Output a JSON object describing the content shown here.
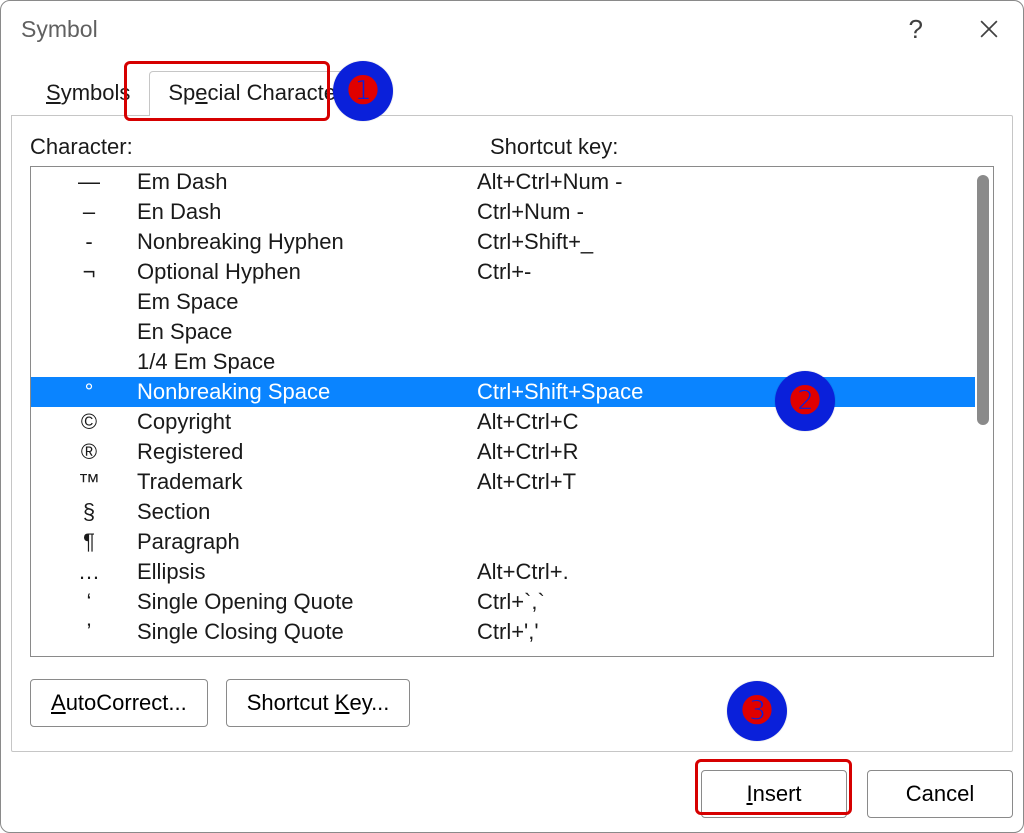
{
  "title": "Symbol",
  "tabs": {
    "symbols": {
      "prefix": "S",
      "rest": "ymbols"
    },
    "special": {
      "prefix": "Sp",
      "mn": "e",
      "rest": "cial Characters"
    }
  },
  "headers": {
    "char": {
      "mn": "C",
      "rest": "haracter:"
    },
    "key": "Shortcut key:"
  },
  "rows": [
    {
      "glyph": "—",
      "name": "Em Dash",
      "shortcut": "Alt+Ctrl+Num -"
    },
    {
      "glyph": "–",
      "name": "En Dash",
      "shortcut": "Ctrl+Num -"
    },
    {
      "glyph": "-",
      "name": "Nonbreaking Hyphen",
      "shortcut": "Ctrl+Shift+_"
    },
    {
      "glyph": "¬",
      "name": "Optional Hyphen",
      "shortcut": "Ctrl+-"
    },
    {
      "glyph": "",
      "name": "Em Space",
      "shortcut": ""
    },
    {
      "glyph": "",
      "name": "En Space",
      "shortcut": ""
    },
    {
      "glyph": "",
      "name": "1/4 Em Space",
      "shortcut": ""
    },
    {
      "glyph": "°",
      "name": "Nonbreaking Space",
      "shortcut": "Ctrl+Shift+Space",
      "selected": true
    },
    {
      "glyph": "©",
      "name": "Copyright",
      "shortcut": "Alt+Ctrl+C"
    },
    {
      "glyph": "®",
      "name": "Registered",
      "shortcut": "Alt+Ctrl+R"
    },
    {
      "glyph": "™",
      "name": "Trademark",
      "shortcut": "Alt+Ctrl+T"
    },
    {
      "glyph": "§",
      "name": "Section",
      "shortcut": ""
    },
    {
      "glyph": "¶",
      "name": "Paragraph",
      "shortcut": ""
    },
    {
      "glyph": "…",
      "name": "Ellipsis",
      "shortcut": "Alt+Ctrl+."
    },
    {
      "glyph": "‘",
      "name": "Single Opening Quote",
      "shortcut": "Ctrl+`,`"
    },
    {
      "glyph": "’",
      "name": "Single Closing Quote",
      "shortcut": "Ctrl+','"
    }
  ],
  "buttons": {
    "autocorrect": {
      "mn": "A",
      "rest": "utoCorrect..."
    },
    "shortcutkey": {
      "pre": "Shortcut ",
      "mn": "K",
      "rest": "ey..."
    },
    "insert": {
      "mn": "I",
      "rest": "nsert"
    },
    "cancel": "Cancel"
  },
  "annotations": {
    "n1": "➊",
    "n2": "➋",
    "n3": "➌"
  }
}
